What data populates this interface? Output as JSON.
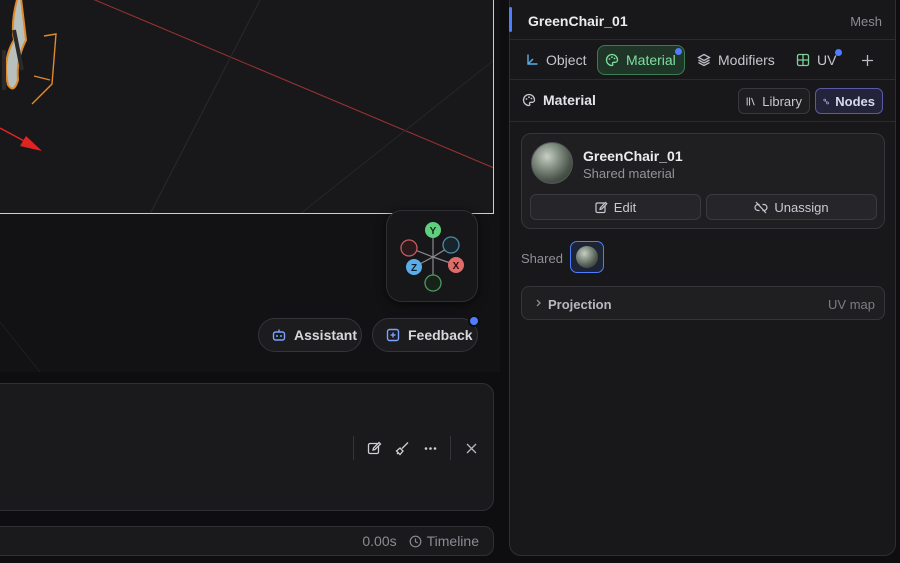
{
  "viewport": {
    "gizmo_axes": {
      "y": "Y",
      "z": "Z",
      "x": "X"
    },
    "colors": {
      "y_axis": "#5fcf7f",
      "x_axis": "#e06b6b",
      "z_axis": "#5aaee8",
      "grid_line": "#c03a3a",
      "selection": "#e08a2a"
    },
    "buttons": {
      "assistant": "Assistant",
      "feedback": "Feedback"
    },
    "icons": {
      "assistant": "robot-icon",
      "feedback": "message-plus-icon"
    }
  },
  "bottom_panel": {
    "tools": [
      "edit-icon",
      "brush-icon",
      "more-icon",
      "close-icon"
    ]
  },
  "timeline": {
    "time": "0.00s",
    "label": "Timeline"
  },
  "inspector": {
    "title": "GreenChair_01",
    "object_type": "Mesh",
    "accent_color": "#4f7dff",
    "tabs": [
      {
        "label": "Object",
        "icon": "axis-icon",
        "active": false
      },
      {
        "label": "Material",
        "icon": "palette-icon",
        "active": true
      },
      {
        "label": "Modifiers",
        "icon": "layers-icon",
        "active": false
      },
      {
        "label": "UV",
        "icon": "grid-icon",
        "active": false
      }
    ],
    "section": {
      "title": "Material",
      "library_label": "Library",
      "nodes_label": "Nodes"
    },
    "material_card": {
      "name": "GreenChair_01",
      "subtitle": "Shared material",
      "edit_label": "Edit",
      "unassign_label": "Unassign"
    },
    "shared_label": "Shared",
    "projection": {
      "title": "Projection",
      "value": "UV map"
    }
  }
}
